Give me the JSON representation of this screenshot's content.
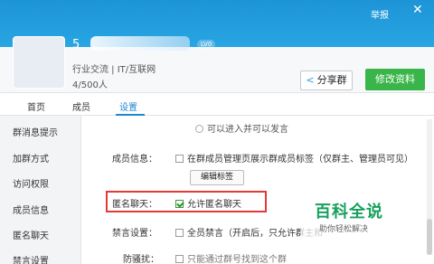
{
  "header": {
    "report_label": "举报",
    "close_icon": "close-icon",
    "group_name_prefix": "5",
    "level_badge": "LV0",
    "category": "行业交流 | IT/互联网",
    "member_count": "4/500人",
    "share_label": "分享群",
    "edit_label": "修改资料"
  },
  "tabs": [
    {
      "label": "首页"
    },
    {
      "label": "成员"
    },
    {
      "label": "设置"
    }
  ],
  "sidebar": {
    "items": [
      {
        "label": "群消息提示"
      },
      {
        "label": "加群方式"
      },
      {
        "label": "访问权限"
      },
      {
        "label": "成员信息"
      },
      {
        "label": "匿名聊天"
      },
      {
        "label": "禁言设置"
      }
    ]
  },
  "settings": {
    "visit_option": "可以进入并可以发言",
    "member_info_label": "成员信息：",
    "member_info_option": "在群成员管理页展示群成员标签（仅群主、管理员可见）",
    "edit_tags_button": "编辑标签",
    "anonymous_label": "匿名聊天：",
    "anonymous_option": "允许匿名聊天",
    "anonymous_checked": true,
    "mute_label": "禁言设置：",
    "mute_option": "全员禁言（开启后，只允许群主和",
    "anti_harass_label": "防骚扰：",
    "anti_harass_option": "只能通过群号找到这个群"
  },
  "watermark": {
    "title": "百科全说",
    "subtitle": "助你轻松解决"
  },
  "colors": {
    "header_blue": "#2aa7e4",
    "active_tab": "#1e88d2",
    "edit_button_green": "#39b54a",
    "highlight_red": "#e53935",
    "watermark_green": "#17a05d"
  }
}
